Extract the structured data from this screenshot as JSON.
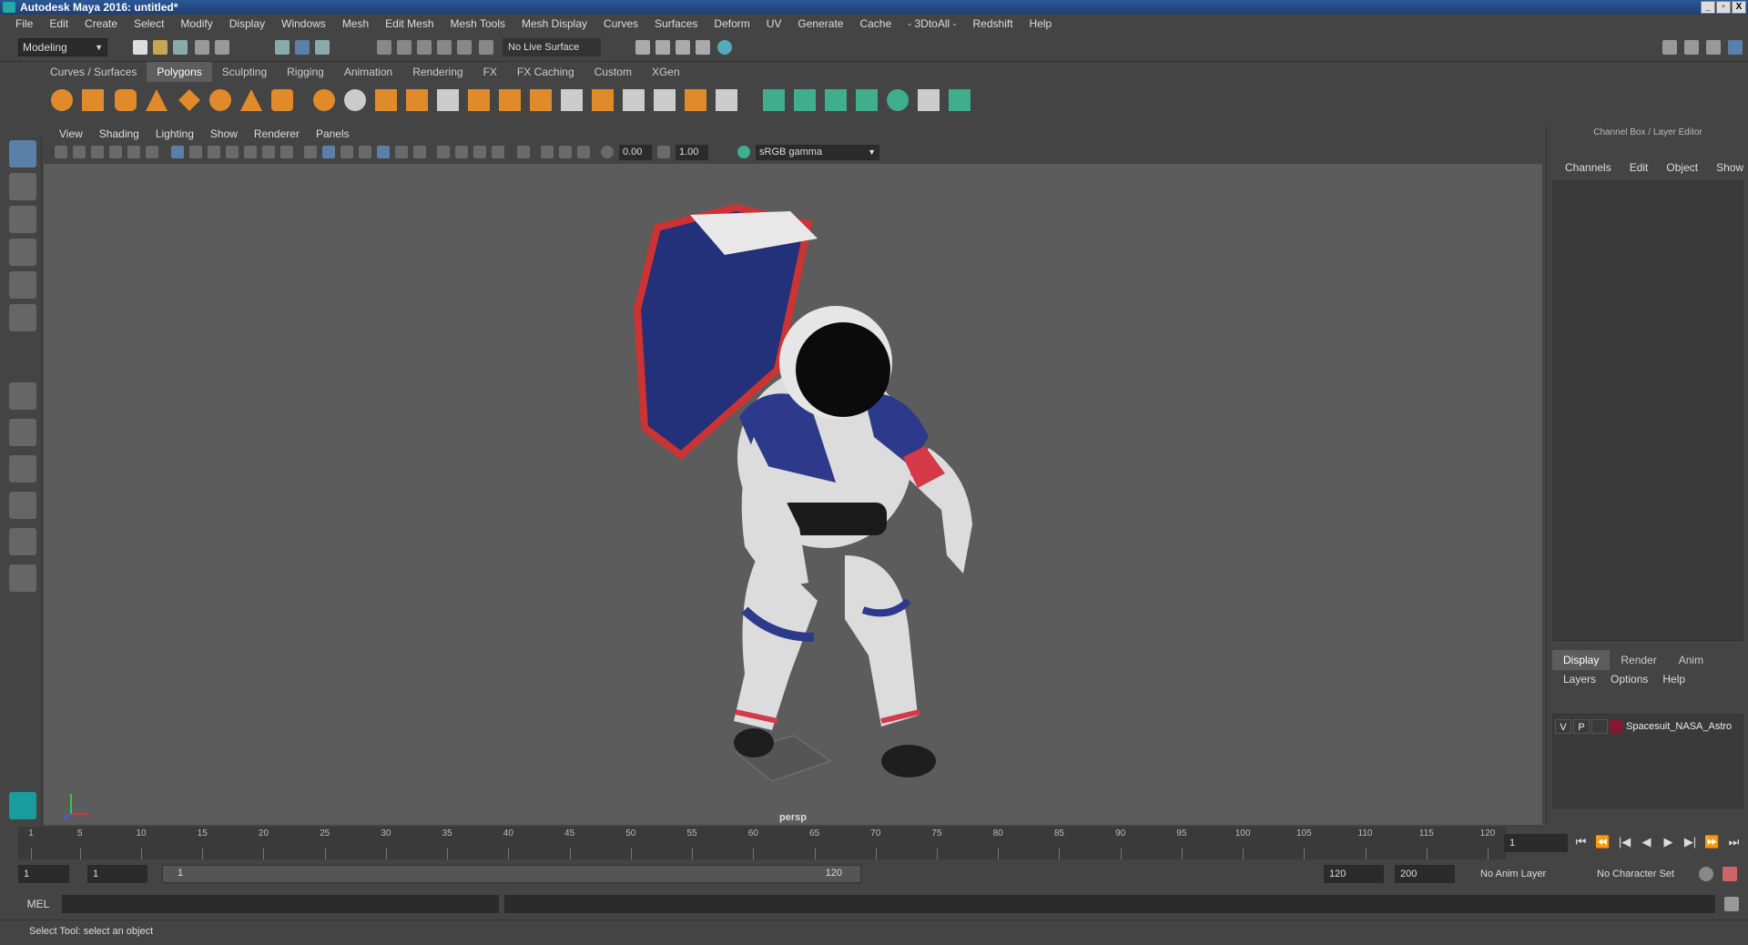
{
  "window": {
    "title": "Autodesk Maya 2016: untitled*",
    "buttons": [
      "_",
      "▫",
      "X"
    ]
  },
  "menubar": [
    "File",
    "Edit",
    "Create",
    "Select",
    "Modify",
    "Display",
    "Windows",
    "Mesh",
    "Edit Mesh",
    "Mesh Tools",
    "Mesh Display",
    "Curves",
    "Surfaces",
    "Deform",
    "UV",
    "Generate",
    "Cache",
    "- 3DtoAll -",
    "Redshift",
    "Help"
  ],
  "status_line": {
    "mode": "Modeling",
    "live_surface": "No Live Surface"
  },
  "shelf": {
    "tabs": [
      "Curves / Surfaces",
      "Polygons",
      "Sculpting",
      "Rigging",
      "Animation",
      "Rendering",
      "FX",
      "FX Caching",
      "Custom",
      "XGen"
    ],
    "active_tab": "Polygons"
  },
  "viewport": {
    "menu": [
      "View",
      "Shading",
      "Lighting",
      "Show",
      "Renderer",
      "Panels"
    ],
    "exposure": "0.00",
    "gamma": "1.00",
    "color_space": "sRGB gamma",
    "camera_label": "persp"
  },
  "channel_box": {
    "title": "Channel Box / Layer Editor",
    "menu": [
      "Channels",
      "Edit",
      "Object",
      "Show"
    ]
  },
  "layer_editor": {
    "tabs": [
      "Display",
      "Render",
      "Anim"
    ],
    "active_tab": "Display",
    "menu": [
      "Layers",
      "Options",
      "Help"
    ],
    "layers": [
      {
        "visible": "V",
        "playback": "P",
        "name": "Spacesuit_NASA_Astro",
        "color": "#8a1530"
      }
    ]
  },
  "time_slider": {
    "ticks": [
      "1",
      "5",
      "10",
      "15",
      "20",
      "25",
      "30",
      "35",
      "40",
      "45",
      "50",
      "55",
      "60",
      "65",
      "70",
      "75",
      "80",
      "85",
      "90",
      "95",
      "100",
      "105",
      "110",
      "115",
      "120"
    ],
    "current_frame": "1",
    "playback_icons": [
      "⏮",
      "⏪",
      "|◀",
      "◀",
      "▶",
      "▶|",
      "⏩",
      "⏭"
    ]
  },
  "range_slider": {
    "start_time": "1",
    "playback_start": "1",
    "slider_start": "1",
    "slider_end": "120",
    "playback_end": "120",
    "end_time": "200",
    "anim_layer": "No Anim Layer",
    "character_set": "No Character Set"
  },
  "command_line": {
    "language": "MEL"
  },
  "help_line": "Select Tool: select an object",
  "colors": {
    "viewport_bg": "#5c5c5c",
    "ui_bg": "#444444",
    "selection": "#5a7fa8",
    "shelf_orange": "#e08a2a",
    "shelf_green": "#3fae8a"
  }
}
